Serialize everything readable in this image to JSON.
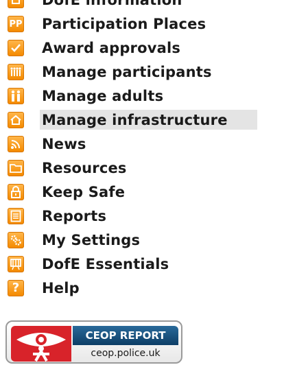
{
  "menu": {
    "items": [
      {
        "label": "DofE information",
        "icon": "info-icon"
      },
      {
        "label": "Participation Places",
        "icon": "pp-icon",
        "icon_text": "PP"
      },
      {
        "label": "Award approvals",
        "icon": "checkmark-icon"
      },
      {
        "label": "Manage participants",
        "icon": "people-group-icon"
      },
      {
        "label": "Manage adults",
        "icon": "adults-icon"
      },
      {
        "label": "Manage infrastructure",
        "icon": "house-icon",
        "active": true
      },
      {
        "label": "News",
        "icon": "rss-icon"
      },
      {
        "label": "Resources",
        "icon": "folder-icon"
      },
      {
        "label": "Keep Safe",
        "icon": "padlock-icon"
      },
      {
        "label": "Reports",
        "icon": "report-icon"
      },
      {
        "label": "My Settings",
        "icon": "gears-icon"
      },
      {
        "label": "DofE Essentials",
        "icon": "essentials-icon"
      },
      {
        "label": "Help",
        "icon": "question-icon",
        "icon_text": "?"
      }
    ]
  },
  "ceop": {
    "title": "CEOP REPORT",
    "url": "ceop.police.uk"
  },
  "colors": {
    "icon_orange": "#f48a00",
    "active_bg": "#e4e4e4",
    "ceop_red": "#d8232a",
    "ceop_blue": "#0d3e66"
  }
}
